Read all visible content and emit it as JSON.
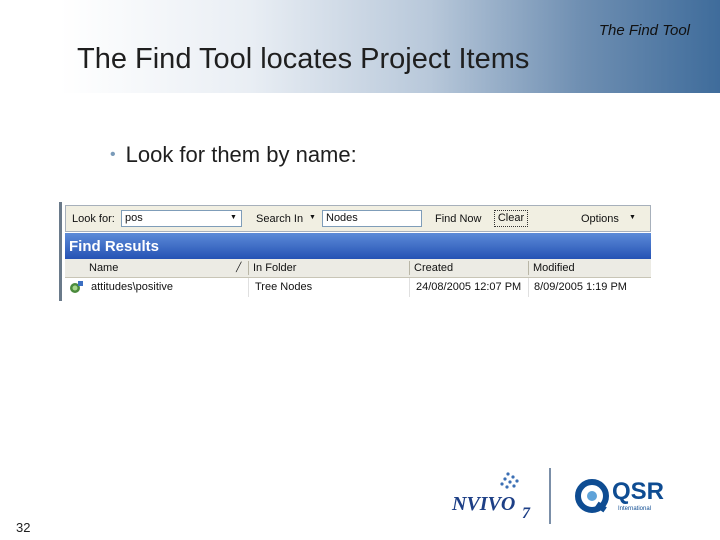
{
  "slide": {
    "tag": "The Find Tool",
    "title": "The Find Tool locates Project Items",
    "bullet": "Look for them by name:",
    "page_number": "32"
  },
  "find_bar": {
    "look_for_label": "Look for:",
    "look_for_value": "pos",
    "search_in_label": "Search In",
    "search_in_value": "Nodes",
    "find_now_label": "Find Now",
    "clear_label": "Clear",
    "options_label": "Options"
  },
  "results": {
    "header": "Find Results",
    "columns": [
      "Name",
      "In Folder",
      "Created",
      "Modified"
    ],
    "rows": [
      [
        "attitudes\\positive",
        "Tree Nodes",
        "24/08/2005 12:07 PM",
        "8/09/2005 1:19 PM"
      ]
    ]
  },
  "logos": {
    "qsr": "QSR",
    "qsr_sub": "International"
  },
  "colors": {
    "results_header": "#2552b4",
    "banner_dark": "#3f6c9b",
    "qsr_blue": "#0e4c92"
  }
}
